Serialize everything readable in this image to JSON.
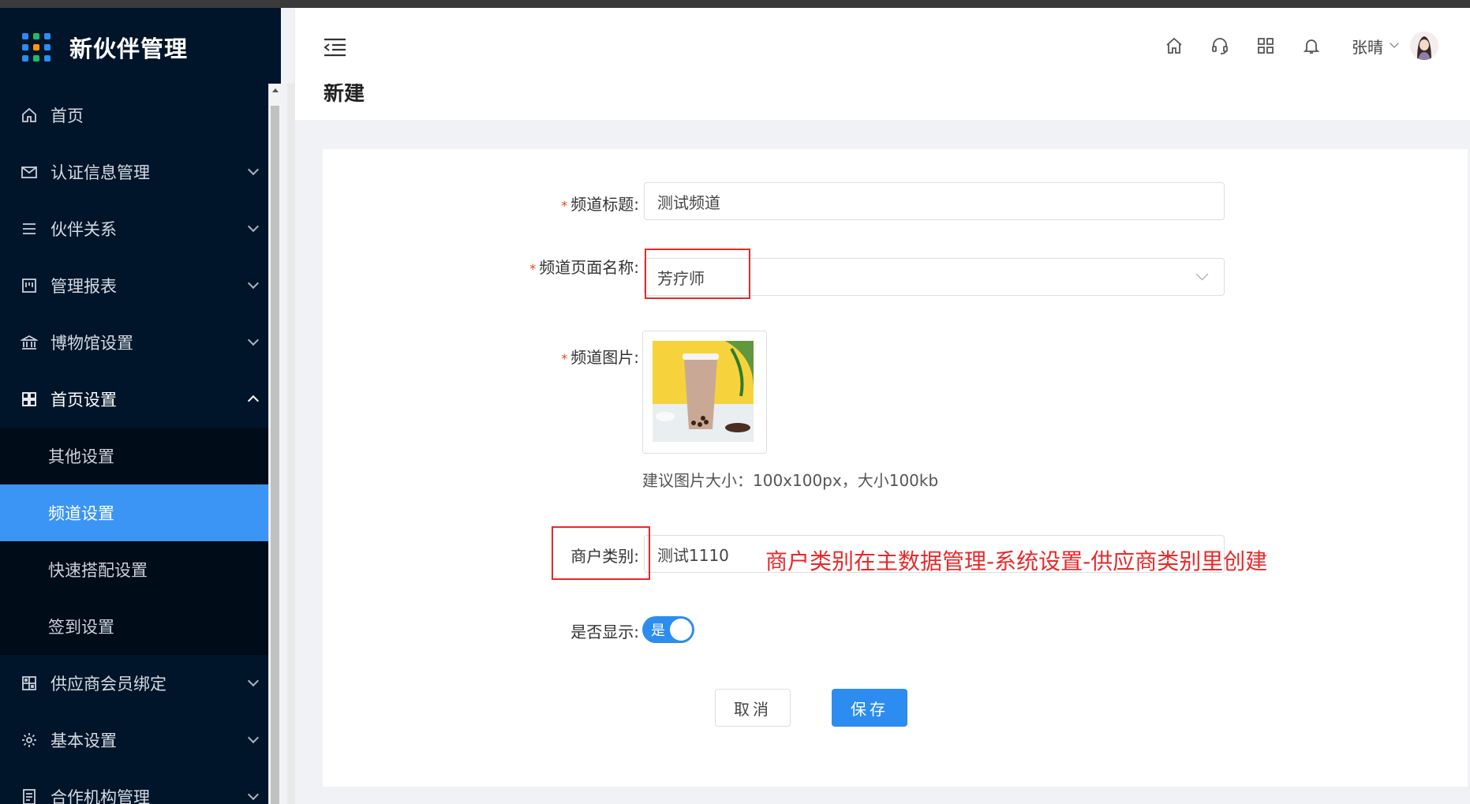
{
  "app": {
    "title": "新伙伴管理"
  },
  "sidebar": {
    "items": [
      {
        "label": "首页",
        "icon": "home-icon"
      },
      {
        "label": "认证信息管理",
        "icon": "mail-icon"
      },
      {
        "label": "伙伴关系",
        "icon": "list-icon"
      },
      {
        "label": "管理报表",
        "icon": "board-icon"
      },
      {
        "label": "博物馆设置",
        "icon": "museum-icon"
      },
      {
        "label": "首页设置",
        "icon": "grid-icon"
      },
      {
        "label": "供应商会员绑定",
        "icon": "qr-icon"
      },
      {
        "label": "基本设置",
        "icon": "gear-icon"
      },
      {
        "label": "合作机构管理",
        "icon": "document-icon"
      }
    ],
    "submenu": [
      {
        "label": "其他设置"
      },
      {
        "label": "频道设置"
      },
      {
        "label": "快速搭配设置"
      },
      {
        "label": "签到设置"
      }
    ]
  },
  "header": {
    "user_name": "张晴",
    "icons": [
      "home-icon",
      "headset-icon",
      "apps-icon",
      "bell-icon"
    ]
  },
  "page": {
    "title": "新建"
  },
  "form": {
    "channel_title": {
      "label": "频道标题:",
      "value": "测试频道"
    },
    "page_name": {
      "label": "频道页面名称:",
      "value": "芳疗师"
    },
    "channel_image": {
      "label": "频道图片:",
      "hint": "建议图片大小：100x100px，大小100kb"
    },
    "merchant_type": {
      "label": "商户类别:",
      "value": "测试1110"
    },
    "show": {
      "label": "是否显示:",
      "switch_text": "是",
      "on": true
    },
    "cancel_label": "取消",
    "save_label": "保存"
  },
  "annotation": {
    "text": "商户类别在主数据管理-系统设置-供应商类别里创建"
  },
  "colors": {
    "sidebar": "#00152a",
    "accent": "#2d8cf0",
    "annotation": "#e8292a"
  }
}
